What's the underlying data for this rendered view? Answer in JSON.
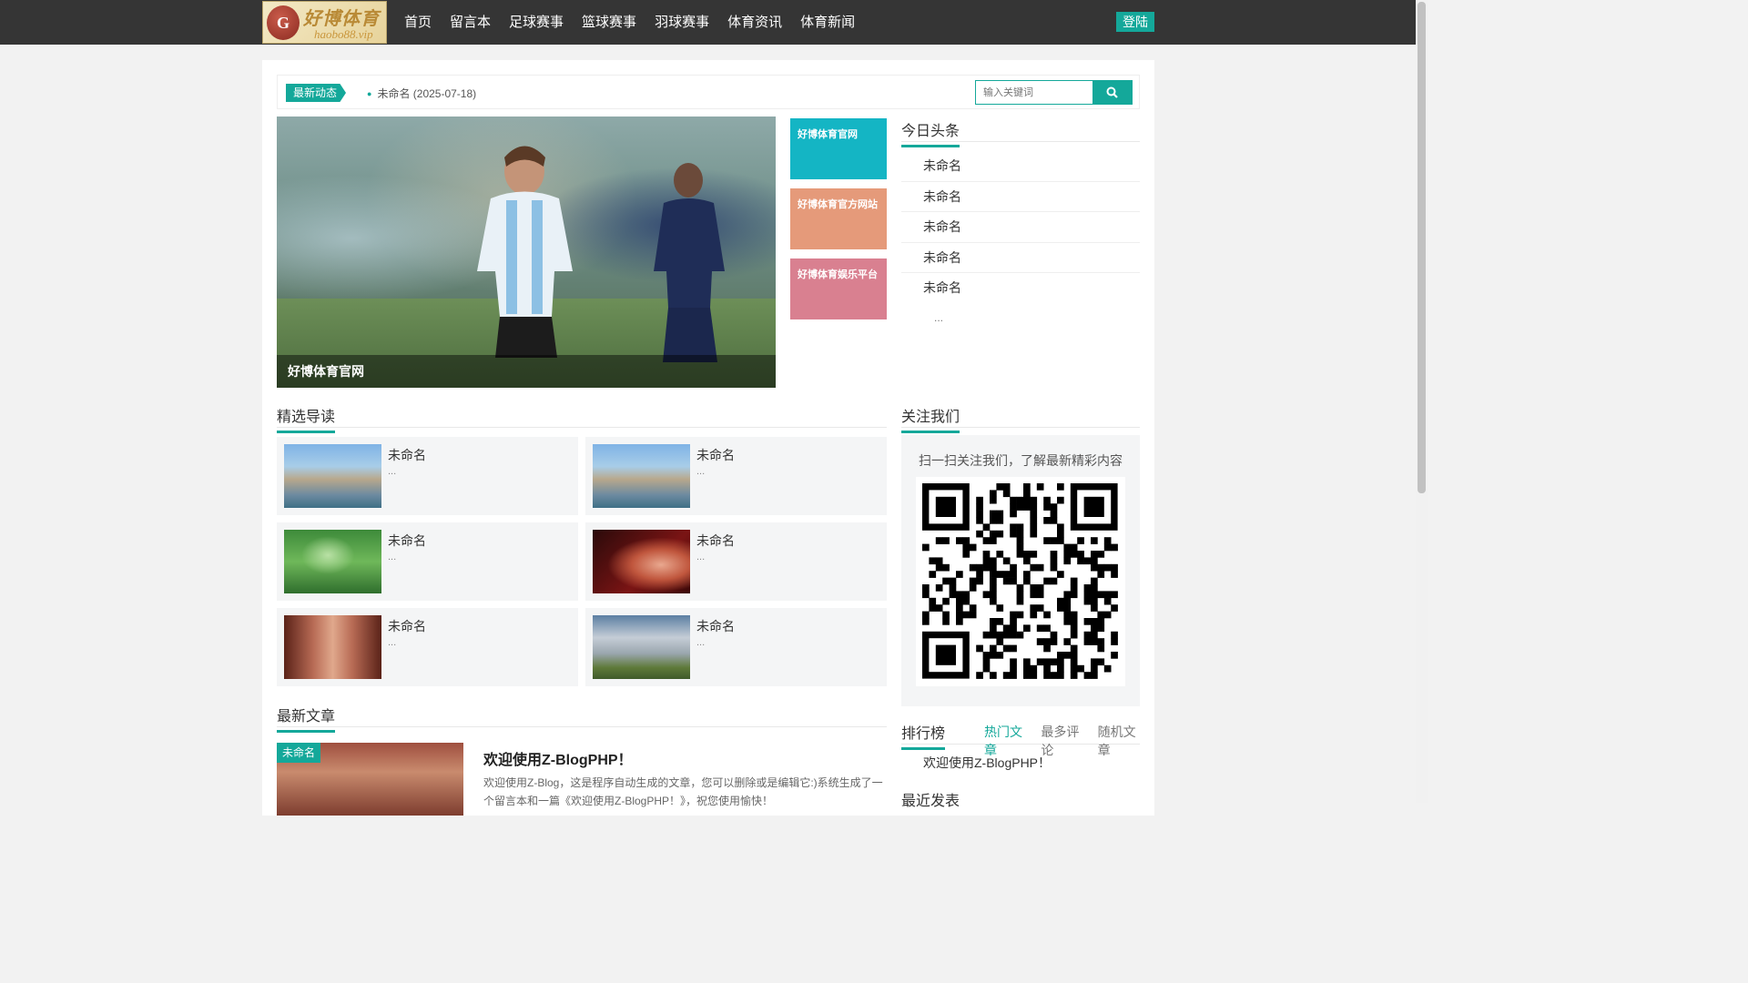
{
  "header": {
    "logo": {
      "badge": "G",
      "brand": "好博体育",
      "domain": "haobo88.vip"
    },
    "nav": [
      "首页",
      "留言本",
      "足球赛事",
      "篮球赛事",
      "羽球赛事",
      "体育资讯",
      "体育新闻"
    ],
    "login_label": "登陆"
  },
  "ticker": {
    "label": "最新动态",
    "item": "未命名 (2025-07-18)"
  },
  "search": {
    "placeholder": "输入关键词"
  },
  "hero": {
    "caption": "好博体育官网"
  },
  "promos": [
    {
      "label": "好博体育官网",
      "color": "#14b5c4"
    },
    {
      "label": "好博体育官方网站",
      "color": "#e59a7a"
    },
    {
      "label": "好博体育娱乐平台",
      "color": "#d98090"
    }
  ],
  "today": {
    "title": "今日头条",
    "items": [
      "未命名",
      "未命名",
      "未命名",
      "未命名",
      "未命名"
    ],
    "more": "..."
  },
  "featured": {
    "title": "精选导读",
    "items": [
      {
        "title": "未命名",
        "desc": "...",
        "image": "rocks-lake"
      },
      {
        "title": "未命名",
        "desc": "...",
        "image": "rocks-lake"
      },
      {
        "title": "未命名",
        "desc": "...",
        "image": "green-heart"
      },
      {
        "title": "未命名",
        "desc": "...",
        "image": "hand-piano"
      },
      {
        "title": "未命名",
        "desc": "...",
        "image": "red-forest"
      },
      {
        "title": "未命名",
        "desc": "...",
        "image": "tree-sky"
      }
    ]
  },
  "follow": {
    "title": "关注我们",
    "text": "扫一扫关注我们，了解最新精彩内容"
  },
  "ranking": {
    "title": "排行榜",
    "tabs": [
      "热门文章",
      "最多评论",
      "随机文章"
    ],
    "active": 0,
    "items": [
      "欢迎使用Z-BlogPHP！"
    ]
  },
  "recent_title": "最近发表",
  "latest": {
    "title": "最新文章",
    "post": {
      "tag": "未命名",
      "title": "欢迎使用Z-BlogPHP！",
      "excerpt": "欢迎使用Z-Blog，这是程序自动生成的文章，您可以删除或是编辑它:)系统生成了一个留言本和一篇《欢迎使用Z-BlogPHP！》，祝您使用愉快！"
    }
  },
  "colors": {
    "accent": "#14a89a",
    "topbar": "#353535"
  }
}
